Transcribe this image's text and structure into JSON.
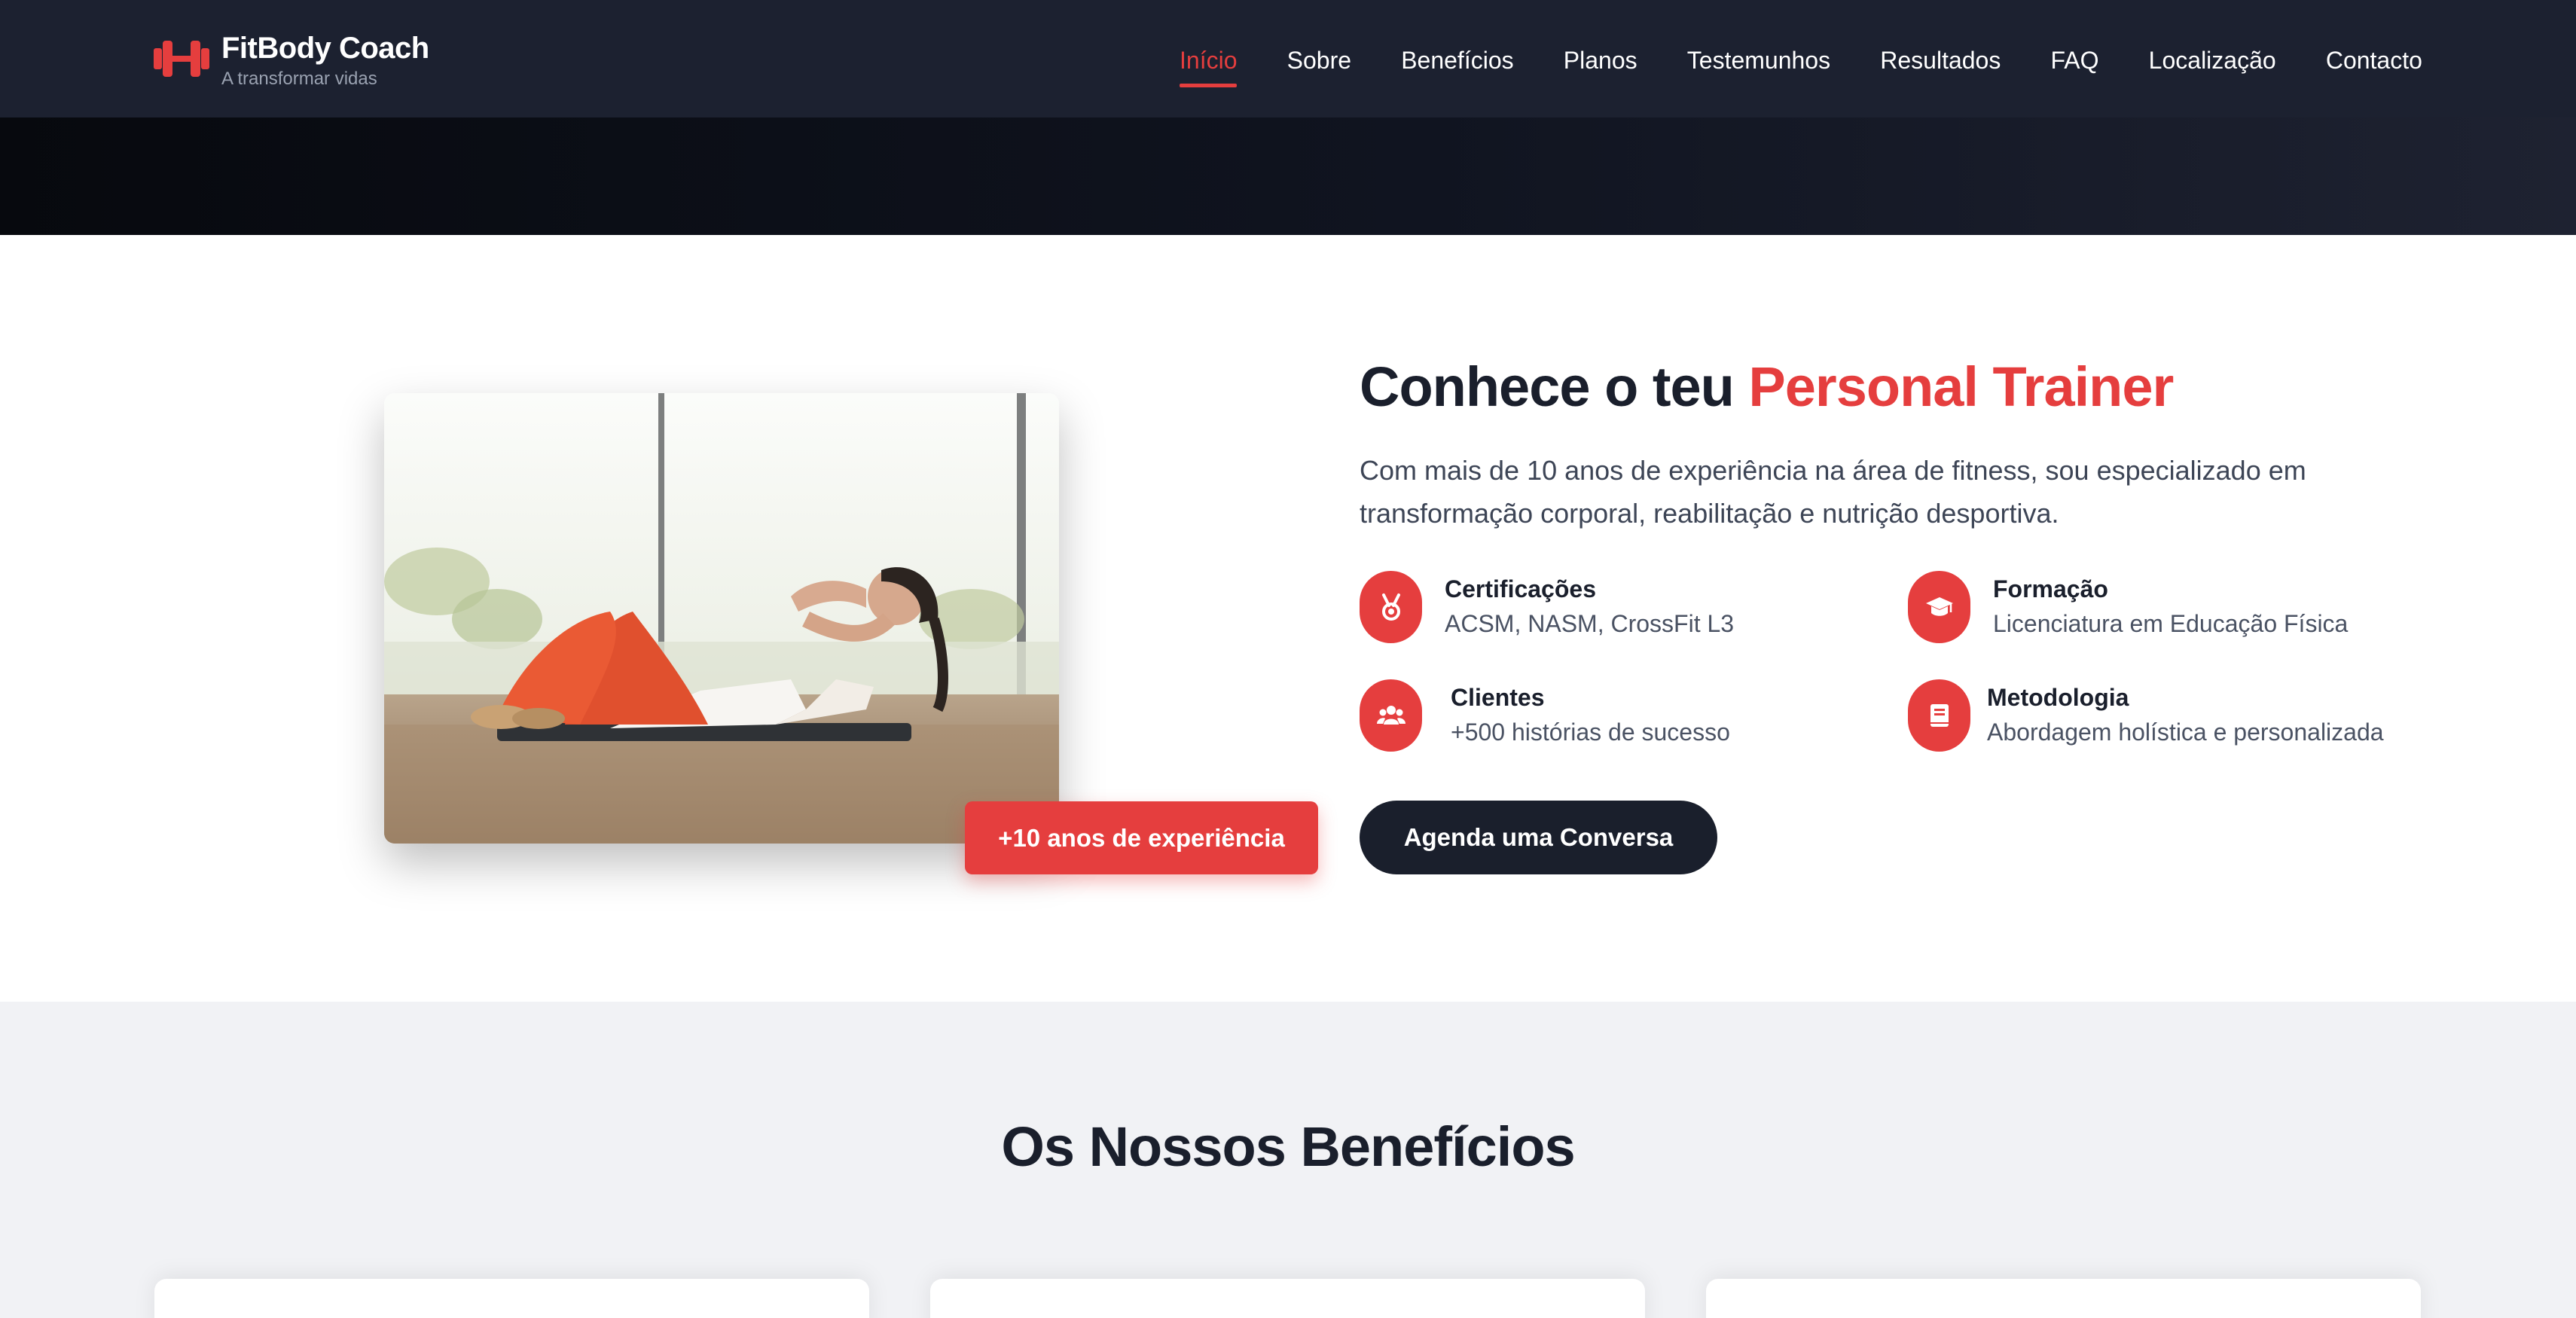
{
  "brand": {
    "name": "FitBody Coach",
    "tagline": "A transformar vidas",
    "icon": "dumbbell-icon"
  },
  "nav": {
    "items": [
      {
        "label": "Início",
        "active": true
      },
      {
        "label": "Sobre"
      },
      {
        "label": "Benefícios"
      },
      {
        "label": "Planos"
      },
      {
        "label": "Testemunhos"
      },
      {
        "label": "Resultados"
      },
      {
        "label": "FAQ"
      },
      {
        "label": "Localização"
      },
      {
        "label": "Contacto"
      }
    ]
  },
  "about": {
    "title_prefix": "Conhece o teu",
    "title_accent": "Personal Trainer",
    "description": "Com mais de 10 anos de experiência na área de fitness, sou especializado em transformação corporal, reabilitação e nutrição desportiva.",
    "experience_badge": "+10 anos de experiência",
    "features": [
      {
        "title": "Certificações",
        "description": "ACSM, NASM, CrossFit L3",
        "icon": "medal-icon"
      },
      {
        "title": "Formação",
        "description": "Licenciatura em Educação Física",
        "icon": "graduation-cap-icon"
      },
      {
        "title": "Clientes",
        "description": "+500 histórias de sucesso",
        "icon": "users-icon"
      },
      {
        "title": "Metodologia",
        "description": "Abordagem holística e personalizada",
        "icon": "book-icon"
      }
    ],
    "cta_label": "Agenda uma Conversa"
  },
  "benefits": {
    "title": "Os Nossos Benefícios"
  },
  "colors": {
    "accent": "#e53e3e",
    "dark": "#1a1f2c",
    "header": "#1c2130",
    "section_bg": "#f1f2f5"
  }
}
